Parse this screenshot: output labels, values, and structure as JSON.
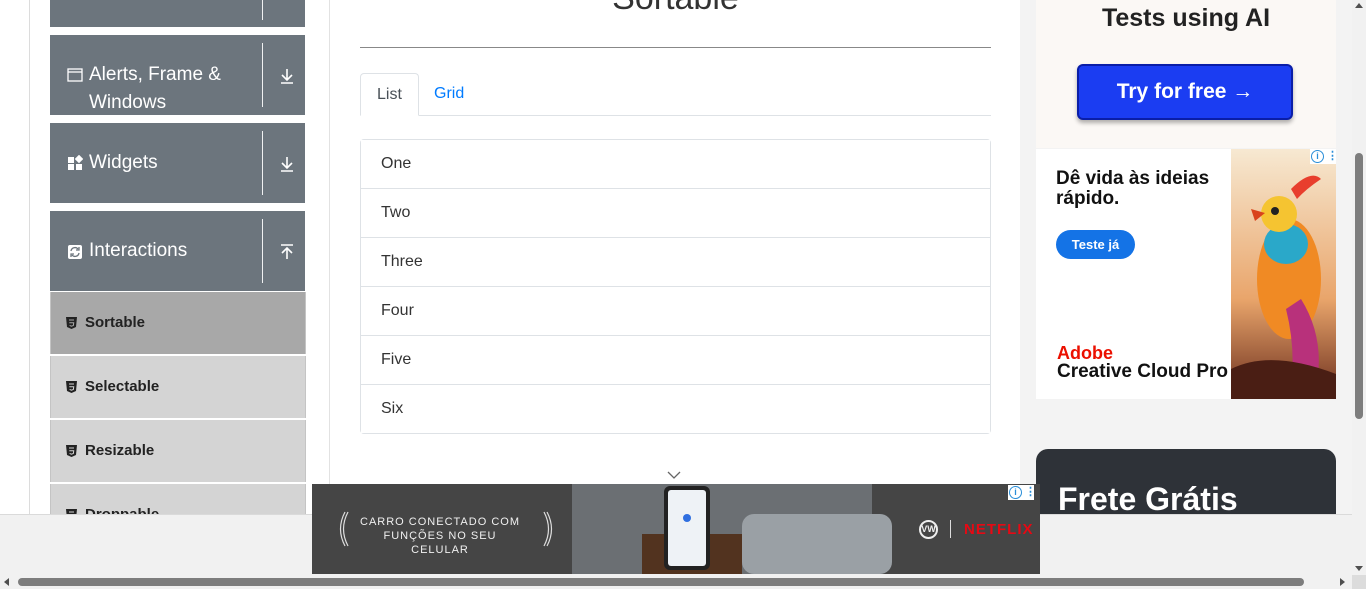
{
  "sidebar": {
    "groups": [
      {
        "label": "",
        "icon": "hidden-icon",
        "toggle": "download-arrow-icon"
      },
      {
        "label_line1": "Alerts, Frame &",
        "label_line2": "Windows",
        "icon": "window-icon",
        "toggle": "download-arrow-icon"
      },
      {
        "label": "Widgets",
        "icon": "widgets-icon",
        "toggle": "download-arrow-icon"
      },
      {
        "label": "Interactions",
        "icon": "interactions-icon",
        "toggle": "upload-arrow-icon"
      }
    ],
    "items": [
      {
        "label": "Sortable",
        "active": true
      },
      {
        "label": "Selectable",
        "active": false
      },
      {
        "label": "Resizable",
        "active": false
      },
      {
        "label": "Droppable",
        "active": false
      }
    ]
  },
  "main": {
    "title": "Sortable",
    "tabs": [
      {
        "label": "List",
        "active": true
      },
      {
        "label": "Grid",
        "active": false
      }
    ],
    "list_items": [
      "One",
      "Two",
      "Three",
      "Four",
      "Five",
      "Six"
    ]
  },
  "ads": {
    "top": {
      "headline": "Tests using AI",
      "cta": "Try for free →"
    },
    "adobe": {
      "headline": "Dê vida às ideias rápido.",
      "cta": "Teste já",
      "brand": "Adobe",
      "product": "Creative Cloud Pro"
    },
    "frete": {
      "headline": "Frete Grátis"
    },
    "banner": {
      "line1": "CARRO CONECTADO COM",
      "line2": "FUNÇÕES NO SEU CELULAR",
      "brand": "NETFLIX"
    }
  },
  "colors": {
    "sidebar_group": "#6c757d",
    "sidebar_item": "#d4d4d4",
    "sidebar_item_active": "#a8a8a8",
    "link": "#007bff",
    "ad_button": "#1b3df2",
    "adobe_red": "#eb1000",
    "netflix_red": "#e50914"
  }
}
